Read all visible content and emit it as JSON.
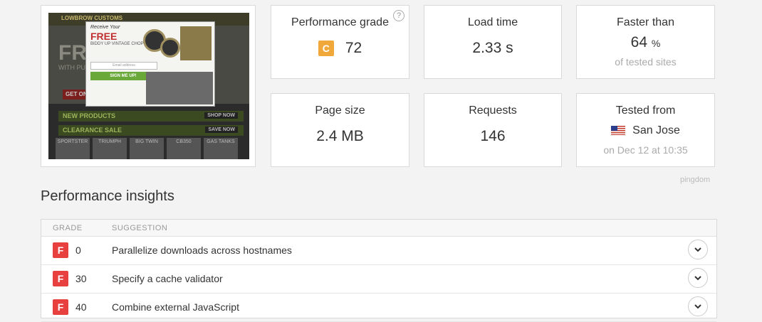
{
  "screenshot": {
    "popup_line1": "Receive Your",
    "popup_line2": "FREE",
    "popup_line3": "BIDDY UP VINTAGE CHOPPER SHOW DVD",
    "popup_email_placeholder": "Email address",
    "popup_button": "SIGN ME UP!",
    "hero_big": "FREE",
    "hero_sub": "WITH PURCHASE GAS TA",
    "get_button": "GET ON",
    "bar1": "NEW PRODUCTS",
    "bar1_btn": "SHOP NOW",
    "bar2": "CLEARANCE SALE",
    "bar2_btn": "SAVE NOW",
    "thumbs": [
      "SPORTSTER",
      "TRIUMPH",
      "BIG TWIN",
      "CB350",
      "GAS TANKS"
    ]
  },
  "metrics": {
    "grade": {
      "title": "Performance grade",
      "letter": "C",
      "value": "72",
      "help": "?",
      "color": "#f0a83a"
    },
    "load_time": {
      "title": "Load time",
      "value": "2.33 s"
    },
    "faster_than": {
      "title": "Faster than",
      "value": "64",
      "unit": "%",
      "sub": "of tested sites"
    },
    "page_size": {
      "title": "Page size",
      "value": "2.4 MB"
    },
    "requests": {
      "title": "Requests",
      "value": "146"
    },
    "tested_from": {
      "title": "Tested from",
      "location": "San Jose",
      "sub": "on Dec 12 at 10:35",
      "flag_icon": "us-flag-icon"
    }
  },
  "brand": "pingdom",
  "insights": {
    "title": "Performance insights",
    "col_grade": "GRADE",
    "col_suggestion": "SUGGESTION",
    "rows": [
      {
        "letter": "F",
        "score": "0",
        "suggestion": "Parallelize downloads across hostnames"
      },
      {
        "letter": "F",
        "score": "30",
        "suggestion": "Specify a cache validator"
      },
      {
        "letter": "F",
        "score": "40",
        "suggestion": "Combine external JavaScript"
      }
    ],
    "grade_color": "#e8403e"
  }
}
